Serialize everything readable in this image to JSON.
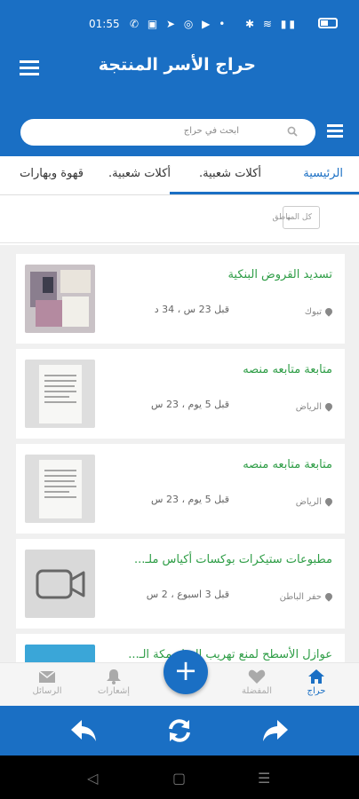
{
  "status_bar": {
    "time": "01:55"
  },
  "app_bar": {
    "title": "حراج الأسر المنتجة"
  },
  "search": {
    "placeholder": "ابحث في حراج"
  },
  "tabs": [
    {
      "label": "الرئيسية",
      "active": true
    },
    {
      "label": "أكلات شعبية."
    },
    {
      "label": "أكلات شعبية."
    },
    {
      "label": "قهوة وبهارات"
    }
  ],
  "location_filter": {
    "value": "كل المناطق"
  },
  "listings": [
    {
      "title": "تسديد القروض البنكية",
      "time": "قبل 23 س ، 34 د",
      "location": "تبوك",
      "thumb": "document-photo"
    },
    {
      "title": "متابعة متابعه منصه",
      "time": "قبل 5 يوم ، 23 س",
      "location": "الرياض",
      "thumb": "paper-document"
    },
    {
      "title": "متابعة متابعه منصه",
      "time": "قبل 5 يوم ، 23 س",
      "location": "الرياض",
      "thumb": "paper-document"
    },
    {
      "title": "مطبوعات ستيكرات بوكسات أكياس ملـ...",
      "time": "قبل 3 اسبوع ، 2 س",
      "location": "حفر الباطن",
      "thumb": "video-icon"
    },
    {
      "title": "عوازل الأسطح لمنع تهريب المياه مكة الـ...",
      "time": "",
      "location": "",
      "thumb": "blue-image"
    }
  ],
  "bottom_nav": [
    {
      "label": "حراج",
      "icon": "home-icon",
      "active": true
    },
    {
      "label": "المفضلة",
      "icon": "heart-icon"
    },
    {
      "label": "إشعارات",
      "icon": "bell-icon"
    },
    {
      "label": "الرسائل",
      "icon": "mail-icon"
    }
  ],
  "colors": {
    "primary": "#1a6fc4",
    "title_green": "#2e9d46",
    "background": "#f0f0f0"
  }
}
